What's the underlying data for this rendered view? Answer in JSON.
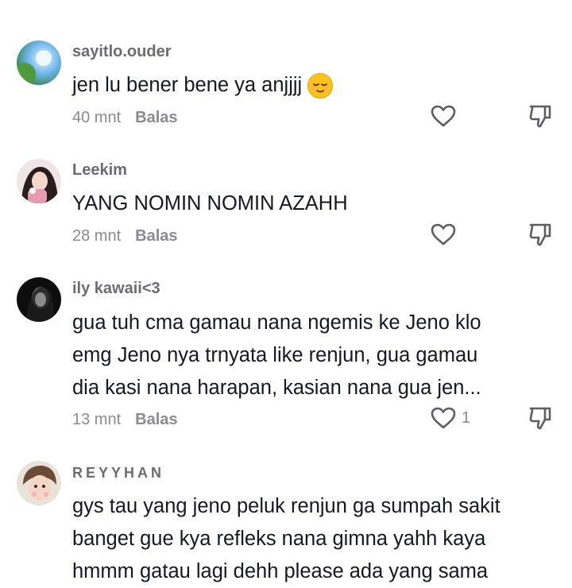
{
  "comments": [
    {
      "username": "sayitlo.ouder",
      "text": "jen lu bener bene ya anjjjj",
      "emoji": "relieved-face-emoji",
      "time": "40 mnt",
      "reply_label": "Balas",
      "likes": ""
    },
    {
      "username": "Leekim",
      "text": "YANG NOMIN NOMIN AZAHH",
      "time": "28 mnt",
      "reply_label": "Balas",
      "likes": ""
    },
    {
      "username": "ily kawaii<3",
      "text_lines": [
        "gua tuh cma gamau nana ngemis ke Jeno klo",
        "emg Jeno nya trnyata like renjun, gua gamau",
        "dia kasi nana harapan, kasian nana gua jen..."
      ],
      "time": "13 mnt",
      "reply_label": "Balas",
      "likes": "1"
    },
    {
      "username": "REYYHAN",
      "text_lines": [
        "gys tau yang jeno peluk renjun ga sumpah sakit",
        "banget gue kya refleks nana gimna yahh kaya",
        "hmmm gatau lagi dehh please ada yang sama"
      ]
    }
  ],
  "icons": {
    "like": "heart-outline-icon",
    "dislike": "thumbs-down-icon"
  },
  "colors": {
    "text": "#161823",
    "muted": "#8a8b91",
    "username": "#6b6b72"
  }
}
